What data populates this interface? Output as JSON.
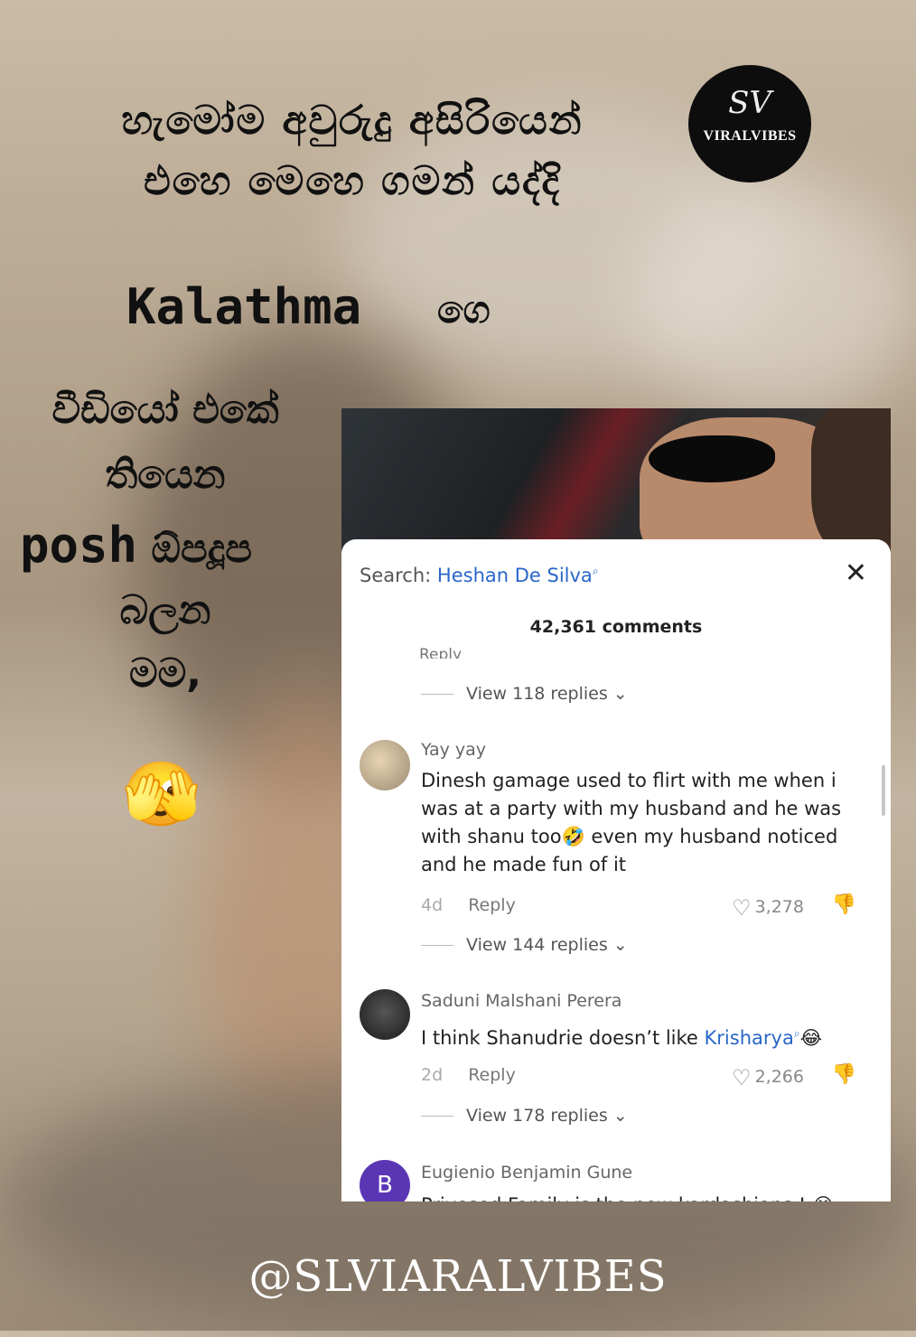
{
  "overlay": {
    "line1": "හැමෝම අවුරුදු අසිරියෙන්",
    "line2": "එහෙ මෙහෙ ගමන් යද්දි",
    "kalathma": "Kalathma",
    "kalathma_suffix": "ගෙ",
    "left_col": [
      "වීඩියෝ එකේ",
      "තියෙන",
      "ඕපදූප",
      "බලන",
      "මම,"
    ],
    "posh": "posh",
    "emoji": "🫣"
  },
  "logo": {
    "monogram": "SV",
    "name": "VIRALVIBES"
  },
  "comments_sheet": {
    "search_label": "Search:",
    "search_query": "Heshan De Silva",
    "search_icon": "search-icon",
    "close_glyph": "✕",
    "count": "42,361 comments",
    "cut_text": "Reply",
    "view_replies": [
      "View 118 replies",
      "View 144 replies",
      "View 178 replies"
    ],
    "comments": [
      {
        "name": "Yay yay",
        "text": "Dinesh gamage used to flirt with me when i was at a party with my husband and he was with shanu too🤣 even my husband noticed and he made fun of it",
        "age": "4d",
        "reply": "Reply",
        "likes": "3,278"
      },
      {
        "name": "Saduni Malshani Perera",
        "text_before": "I think Shanudrie doesn’t like ",
        "mention": "Krisharya",
        "text_after": "😂",
        "age": "2d",
        "reply": "Reply",
        "likes": "2,266"
      },
      {
        "name": "Eugienio Benjamin Gune",
        "avatar_letter": "B",
        "text": "Privesed Family is the new kardashians ! 😭"
      }
    ],
    "colors": {
      "mention": "#2a66c8",
      "avatar_b": "#5a36b5"
    }
  },
  "handle": "@SLVIARALVIBES"
}
